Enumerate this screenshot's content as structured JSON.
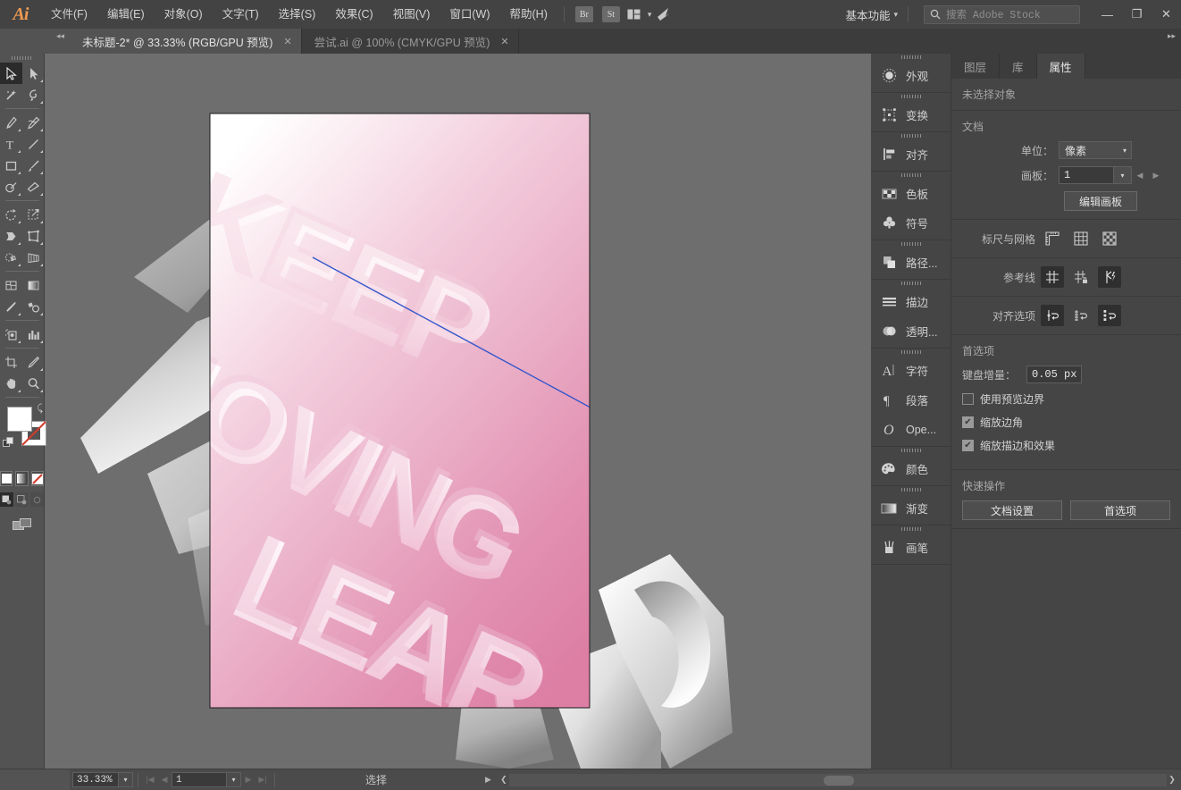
{
  "app": {
    "logo": "Ai",
    "menus": [
      "文件(F)",
      "编辑(E)",
      "对象(O)",
      "文字(T)",
      "选择(S)",
      "效果(C)",
      "视图(V)",
      "窗口(W)",
      "帮助(H)"
    ],
    "quick_apps": [
      "Br",
      "St"
    ],
    "workspace": "基本功能",
    "search_placeholder": "搜索 Adobe Stock",
    "window_buttons": {
      "minimize": "—",
      "maximize": "❐",
      "close": "✕"
    }
  },
  "tabs": [
    {
      "label": "未标题-2* @ 33.33% (RGB/GPU 预览)",
      "close": "✕",
      "active": true
    },
    {
      "label": "尝试.ai @ 100% (CMYK/GPU 预览)",
      "close": "✕",
      "active": false
    }
  ],
  "toolbar": {
    "tools": [
      "selection-tool",
      "direct-selection-tool",
      "magic-wand-tool",
      "lasso-tool",
      "pen-tool",
      "curvature-tool",
      "type-tool",
      "line-segment-tool",
      "rectangle-tool",
      "paintbrush-tool",
      "shaper-tool",
      "eraser-tool",
      "rotate-tool",
      "scale-tool",
      "width-tool",
      "free-transform-tool",
      "shape-builder-tool",
      "perspective-grid-tool",
      "mesh-tool",
      "gradient-tool",
      "eyedropper-tool",
      "blend-tool",
      "symbol-sprayer-tool",
      "column-graph-tool",
      "artboard-tool",
      "slice-tool",
      "hand-tool",
      "zoom-tool"
    ],
    "fill_color": "#ffffff",
    "stroke_color": "#ffffff",
    "color_modes": [
      "color-swatch",
      "gradient-swatch",
      "none-swatch"
    ],
    "draw_modes": [
      "draw-normal",
      "draw-behind",
      "draw-inside"
    ],
    "screen_mode": "screen-mode-toggle"
  },
  "canvas": {
    "artwork_text": "KEEP MOVING LEARN",
    "background": "#6e6e6e",
    "artboard_gradient_from": "#ffffff",
    "artboard_gradient_to": "#df85a8",
    "guide_color": "#3355cc"
  },
  "icon_dock": {
    "groups": [
      {
        "items": [
          {
            "label": "外观",
            "icon": "appearance-icon"
          }
        ]
      },
      {
        "items": [
          {
            "label": "变换",
            "icon": "transform-icon"
          }
        ]
      },
      {
        "items": [
          {
            "label": "对齐",
            "icon": "align-icon"
          }
        ]
      },
      {
        "items": [
          {
            "label": "色板",
            "icon": "swatches-icon"
          },
          {
            "label": "符号",
            "icon": "symbols-icon"
          }
        ]
      },
      {
        "items": [
          {
            "label": "路径...",
            "icon": "pathfinder-icon"
          }
        ]
      },
      {
        "items": [
          {
            "label": "描边",
            "icon": "stroke-icon"
          },
          {
            "label": "透明...",
            "icon": "transparency-icon"
          }
        ]
      },
      {
        "items": [
          {
            "label": "字符",
            "icon": "character-icon"
          },
          {
            "label": "段落",
            "icon": "paragraph-icon"
          },
          {
            "label": "Ope...",
            "icon": "opentype-icon"
          }
        ]
      },
      {
        "items": [
          {
            "label": "颜色",
            "icon": "color-icon"
          }
        ]
      },
      {
        "items": [
          {
            "label": "渐变",
            "icon": "gradient-icon"
          }
        ]
      },
      {
        "items": [
          {
            "label": "画笔",
            "icon": "brushes-icon"
          }
        ]
      }
    ]
  },
  "properties": {
    "tabs": [
      {
        "label": "图层",
        "active": false
      },
      {
        "label": "库",
        "active": false
      },
      {
        "label": "属性",
        "active": true
      }
    ],
    "no_selection": "未选择对象",
    "document": {
      "title": "文档",
      "unit_label": "单位：",
      "unit_value": "像素",
      "artboard_label": "画板：",
      "artboard_value": "1",
      "edit_artboards": "编辑画板"
    },
    "rulers_grid": {
      "title": "标尺与网格",
      "buttons": [
        "show-rulers-icon",
        "show-grid-icon",
        "show-transparency-grid-icon"
      ]
    },
    "guides": {
      "title": "参考线",
      "buttons": [
        "show-guides-icon",
        "lock-guides-icon",
        "smart-guides-icon"
      ]
    },
    "snap_options": {
      "title": "对齐选项",
      "buttons": [
        "snap-to-point-icon",
        "snap-to-grid-icon",
        "snap-to-pixel-icon"
      ]
    },
    "preferences": {
      "title": "首选项",
      "keyboard_increment_label": "键盘增量：",
      "keyboard_increment_value": "0.05 px",
      "checkboxes": [
        {
          "label": "使用预览边界",
          "checked": false
        },
        {
          "label": "缩放边角",
          "checked": true
        },
        {
          "label": "缩放描边和效果",
          "checked": true
        }
      ]
    },
    "quick_actions": {
      "title": "快速操作",
      "buttons": [
        "文档设置",
        "首选项"
      ]
    }
  },
  "statusbar": {
    "zoom": "33.33%",
    "page": "1",
    "status_text": "选择",
    "nav_first": "|◀",
    "nav_prev": "◀",
    "nav_next": "▶",
    "nav_last": "▶|"
  }
}
